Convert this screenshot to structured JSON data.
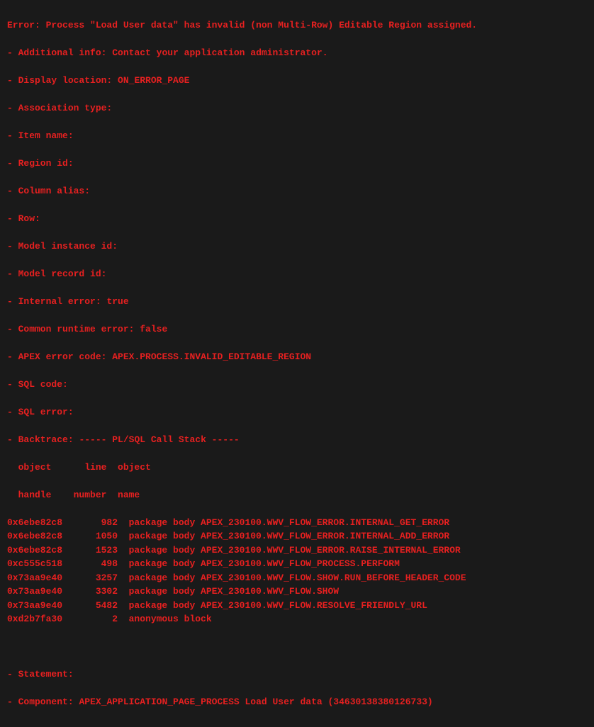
{
  "error": {
    "title": "Error: Process \"Load User data\" has invalid (non Multi-Row) Editable Region assigned.",
    "additional_info_label": "- Additional info:",
    "additional_info_value": "Contact your application administrator.",
    "display_location_label": "- Display location:",
    "display_location_value": "ON_ERROR_PAGE",
    "association_type_label": "- Association type:",
    "association_type_value": "",
    "item_name_label": "- Item name:",
    "item_name_value": "",
    "region_id_label": "- Region id:",
    "region_id_value": "",
    "column_alias_label": "- Column alias:",
    "column_alias_value": "",
    "row_label": "- Row:",
    "row_value": "",
    "model_instance_id_label": "- Model instance id:",
    "model_instance_id_value": "",
    "model_record_id_label": "- Model record id:",
    "model_record_id_value": "",
    "internal_error_label": "- Internal error:",
    "internal_error_value": "true",
    "common_runtime_error_label": "- Common runtime error:",
    "common_runtime_error_value": "false",
    "apex_error_code_label": "- APEX error code:",
    "apex_error_code_value": "APEX.PROCESS.INVALID_EDITABLE_REGION",
    "sql_code_label": "- SQL code:",
    "sql_code_value": "",
    "sql_error_label": "- SQL error:",
    "sql_error_value": "",
    "backtrace_label": "- Backtrace:",
    "backtrace_title": "----- PL/SQL Call Stack -----",
    "stack_header1": "  object      line  object",
    "stack_header2": "  handle    number  name",
    "stack": [
      {
        "handle": "0x6ebe82c8",
        "line": "982",
        "name": "package body APEX_230100.WWV_FLOW_ERROR.INTERNAL_GET_ERROR"
      },
      {
        "handle": "0x6ebe82c8",
        "line": "1050",
        "name": "package body APEX_230100.WWV_FLOW_ERROR.INTERNAL_ADD_ERROR"
      },
      {
        "handle": "0x6ebe82c8",
        "line": "1523",
        "name": "package body APEX_230100.WWV_FLOW_ERROR.RAISE_INTERNAL_ERROR"
      },
      {
        "handle": "0xc555c518",
        "line": "498",
        "name": "package body APEX_230100.WWV_FLOW_PROCESS.PERFORM"
      },
      {
        "handle": "0x73aa9e40",
        "line": "3257",
        "name": "package body APEX_230100.WWV_FLOW.SHOW.RUN_BEFORE_HEADER_CODE"
      },
      {
        "handle": "0x73aa9e40",
        "line": "3302",
        "name": "package body APEX_230100.WWV_FLOW.SHOW"
      },
      {
        "handle": "0x73aa9e40",
        "line": "5482",
        "name": "package body APEX_230100.WWV_FLOW.RESOLVE_FRIENDLY_URL"
      },
      {
        "handle": "0xd2b7fa30",
        "line": "2",
        "name": "anonymous block"
      }
    ],
    "statement_label": "- Statement:",
    "statement_value": "",
    "component_label": "- Component:",
    "component_value": "APEX_APPLICATION_PAGE_PROCESS Load User data (34630138380126733)"
  }
}
